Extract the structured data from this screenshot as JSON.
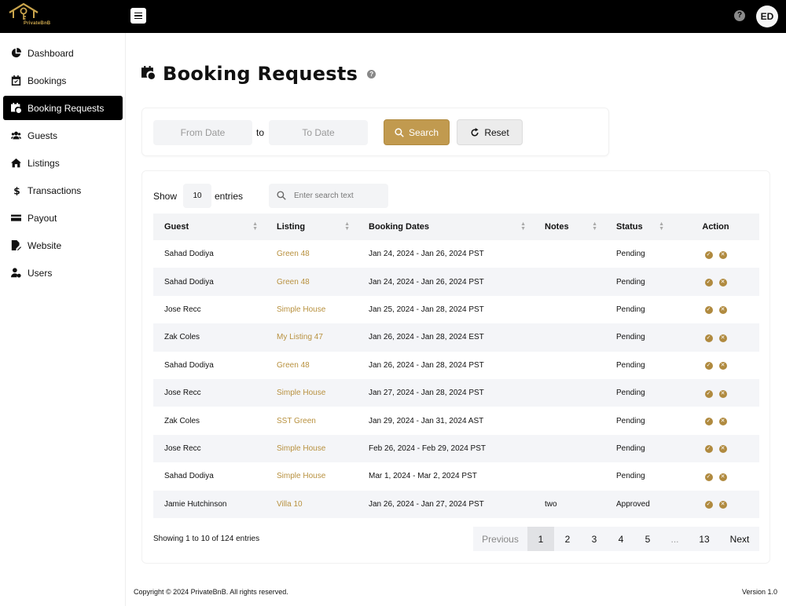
{
  "app": {
    "logo_text": "PrivateBnB",
    "user_initials": "ED",
    "help_glyph": "?"
  },
  "colors": {
    "accent": "#c19a4f",
    "link": "#b8913f",
    "topbar": "#000000",
    "active_nav": "#000000"
  },
  "sidebar": {
    "items": [
      {
        "label": "Dashboard",
        "icon": "pie-chart-icon"
      },
      {
        "label": "Bookings",
        "icon": "calendar-check-icon"
      },
      {
        "label": "Booking Requests",
        "icon": "calendar-clock-icon",
        "active": true
      },
      {
        "label": "Guests",
        "icon": "users-icon"
      },
      {
        "label": "Listings",
        "icon": "home-icon"
      },
      {
        "label": "Transactions",
        "icon": "dollar-icon"
      },
      {
        "label": "Payout",
        "icon": "credit-card-icon"
      },
      {
        "label": "Website",
        "icon": "file-edit-icon"
      },
      {
        "label": "Users",
        "icon": "user-gear-icon"
      }
    ]
  },
  "page": {
    "title": "Booking Requests",
    "help_glyph": "?"
  },
  "filters": {
    "from_placeholder": "From Date",
    "to_label": "to",
    "to_placeholder": "To Date",
    "search_label": "Search",
    "reset_label": "Reset"
  },
  "table_controls": {
    "show_label": "Show",
    "entries_value": "10",
    "entries_label": "entries",
    "search_placeholder": "Enter search text"
  },
  "table": {
    "columns": [
      "Guest",
      "Listing",
      "Booking Dates",
      "Notes",
      "Status",
      "Action"
    ],
    "rows": [
      {
        "guest": "Sahad Dodiya",
        "listing": "Green 48",
        "dates": "Jan 24, 2024 - Jan 26, 2024 PST",
        "notes": "",
        "status": "Pending"
      },
      {
        "guest": "Sahad Dodiya",
        "listing": "Green 48",
        "dates": "Jan 24, 2024 - Jan 26, 2024 PST",
        "notes": "",
        "status": "Pending"
      },
      {
        "guest": "Jose Recc",
        "listing": "Simple House",
        "dates": "Jan 25, 2024 - Jan 28, 2024 PST",
        "notes": "",
        "status": "Pending"
      },
      {
        "guest": "Zak Coles",
        "listing": "My Listing 47",
        "dates": "Jan 26, 2024 - Jan 28, 2024 EST",
        "notes": "",
        "status": "Pending"
      },
      {
        "guest": "Sahad Dodiya",
        "listing": "Green 48",
        "dates": "Jan 26, 2024 - Jan 28, 2024 PST",
        "notes": "",
        "status": "Pending"
      },
      {
        "guest": "Jose Recc",
        "listing": "Simple House",
        "dates": "Jan 27, 2024 - Jan 28, 2024 PST",
        "notes": "",
        "status": "Pending"
      },
      {
        "guest": "Zak Coles",
        "listing": "SST Green",
        "dates": "Jan 29, 2024 - Jan 31, 2024 AST",
        "notes": "",
        "status": "Pending"
      },
      {
        "guest": "Jose Recc",
        "listing": "Simple House",
        "dates": "Feb 26, 2024 - Feb 29, 2024 PST",
        "notes": "",
        "status": "Pending"
      },
      {
        "guest": "Sahad Dodiya",
        "listing": "Simple House",
        "dates": "Mar 1, 2024 - Mar 2, 2024 PST",
        "notes": "",
        "status": "Pending"
      },
      {
        "guest": "Jamie Hutchinson",
        "listing": "Villa 10",
        "dates": "Jan 26, 2024 - Jan 27, 2024 PST",
        "notes": "two",
        "status": "Approved"
      }
    ]
  },
  "pagination": {
    "summary": "Showing 1 to 10 of 124 entries",
    "previous": "Previous",
    "pages": [
      "1",
      "2",
      "3",
      "4",
      "5"
    ],
    "ellipsis": "...",
    "last": "13",
    "next": "Next",
    "current": "1"
  },
  "footer": {
    "copyright": "Copyright © 2024 PrivateBnB. All rights reserved.",
    "version": "Version 1.0"
  }
}
